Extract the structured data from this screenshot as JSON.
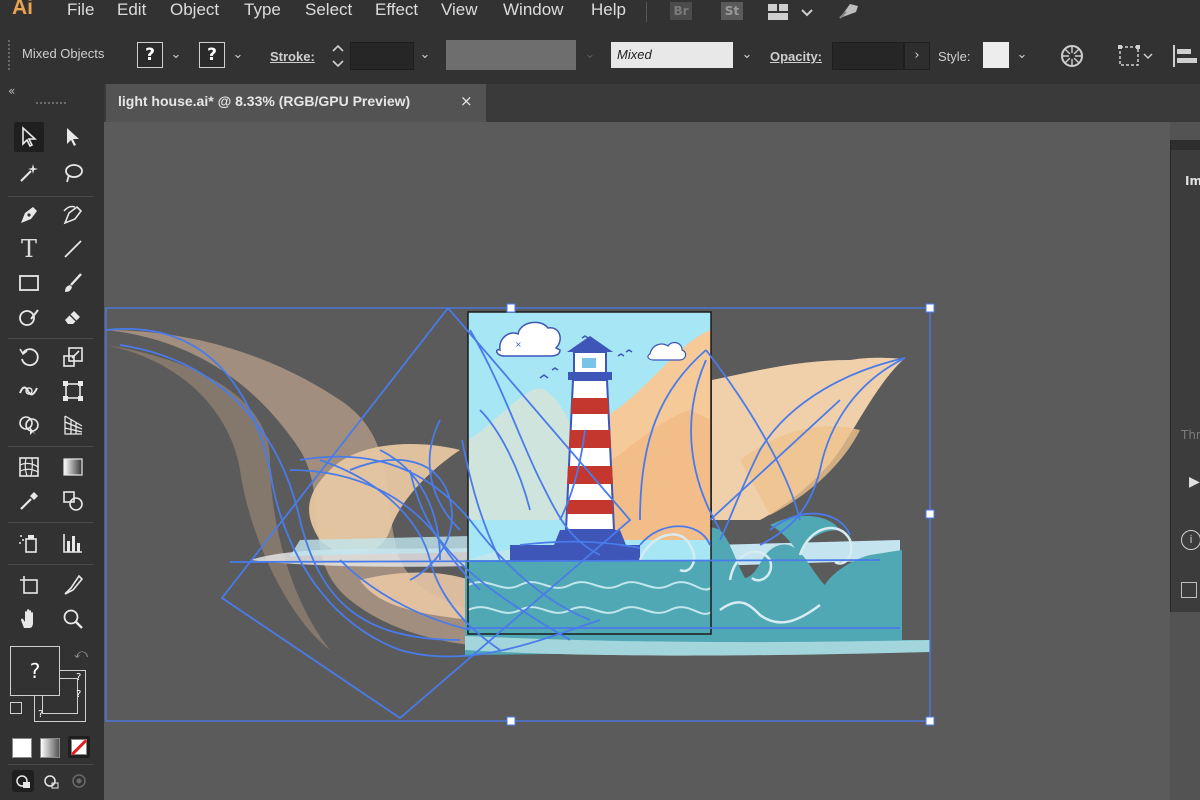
{
  "app": {
    "logo": "Ai",
    "menu": [
      "File",
      "Edit",
      "Object",
      "Type",
      "Select",
      "Effect",
      "View",
      "Window",
      "Help"
    ],
    "bridge_icon": "Br",
    "stock_icon": "St"
  },
  "control_bar": {
    "selection_label": "Mixed Objects",
    "fill_value": "?",
    "stroke_swatch_value": "?",
    "stroke_label": "Stroke:",
    "profile_value": "Mixed",
    "opacity_label": "Opacity:",
    "style_label": "Style:"
  },
  "document": {
    "tab_title": "light house.ai* @ 8.33% (RGB/GPU Preview)",
    "close_glyph": "×"
  },
  "toolbar": {
    "collapse_glyph": "«",
    "fill_stroke_unknown": "?"
  },
  "right_panel": {
    "label_top": "Im",
    "label_mid": "Thr"
  },
  "colors": {
    "sky": "#a6e6f5",
    "water": "#4fa8b3",
    "selection": "#4a7bea",
    "sand": "#f6c999",
    "lighthouse_red": "#c4372f"
  }
}
